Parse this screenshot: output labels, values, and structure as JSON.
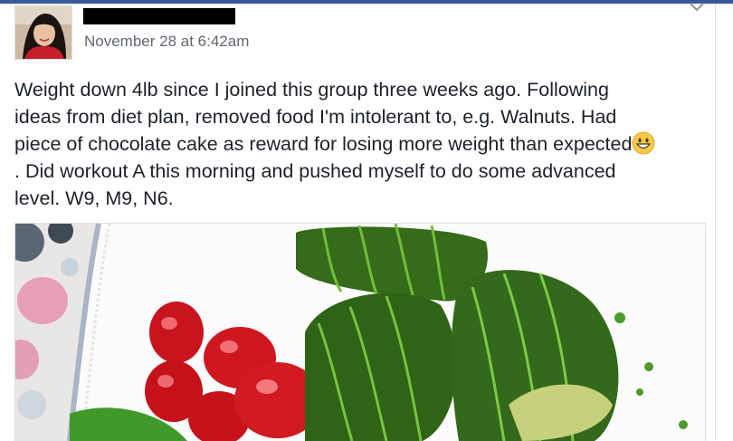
{
  "post": {
    "timestamp": "November 28 at 6:42am",
    "text_line1": "Weight down 4lb since I joined this group three weeks ago. Following",
    "text_line2": "ideas from diet plan, removed food I'm intolerant to, e.g. Walnuts. Had",
    "text_line3": "piece of chocolate cake as reward for losing more weight than expected",
    "text_line4": ". Did workout A this morning and pushed myself to do some advanced",
    "text_line5": "level. W9, M9, N6."
  },
  "icons": {
    "emoji": "grinning-face-emoji",
    "menu": "chevron-down-icon"
  },
  "colors": {
    "brand_bar": "#3b5998",
    "text": "#1d2129",
    "meta": "#616770",
    "avocado": "#3d7a1e",
    "tomato": "#c8141c"
  }
}
